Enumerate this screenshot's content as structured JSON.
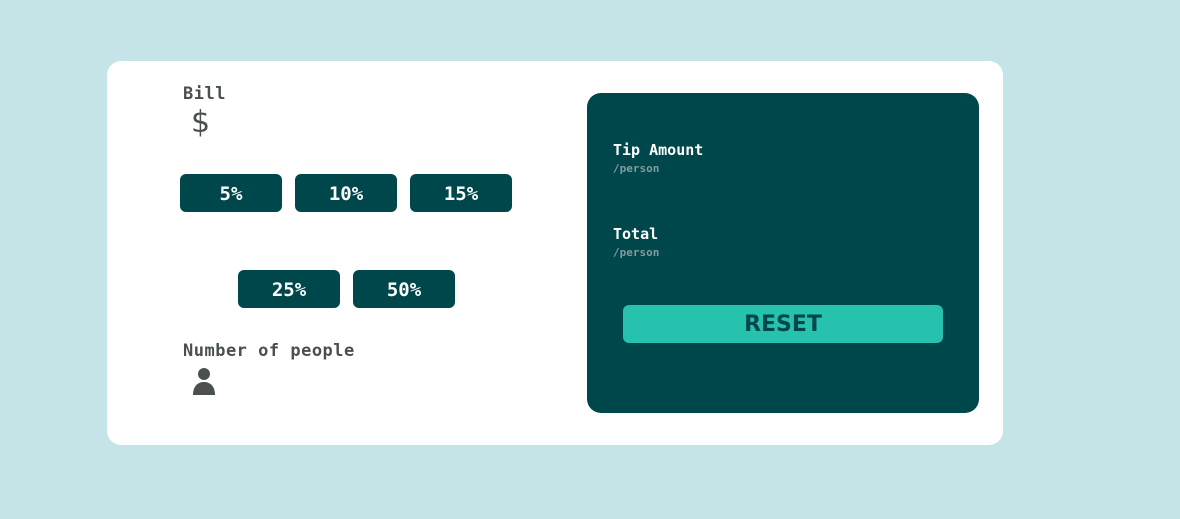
{
  "bill": {
    "label": "Bill",
    "icon": "dollar-icon",
    "icon_glyph": "$"
  },
  "tip": {
    "options": [
      "5%",
      "10%",
      "15%",
      "25%",
      "50%"
    ]
  },
  "people": {
    "label": "Number of people",
    "icon": "person-icon"
  },
  "results": {
    "tip_amount_label": "Tip Amount",
    "tip_amount_sub": "/person",
    "total_label": "Total",
    "total_sub": "/person",
    "reset_label": "RESET"
  },
  "colors": {
    "background": "#c5e4e7",
    "card": "#ffffff",
    "dark_teal": "#00474b",
    "accent": "#26c2ad",
    "muted": "#7f9d9f",
    "label_text": "#4a4f50"
  }
}
